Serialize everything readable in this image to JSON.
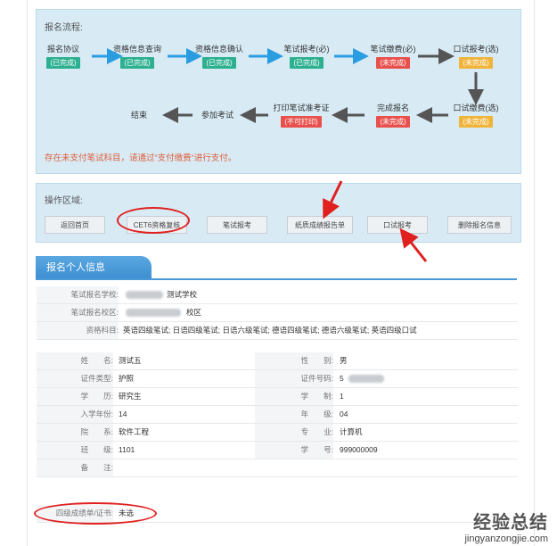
{
  "process": {
    "title": "报名流程:",
    "steps": [
      {
        "label": "报名协议",
        "status": "(已完成)",
        "color": "#2cb08f"
      },
      {
        "label": "资格信息查询",
        "status": "(已完成)",
        "color": "#2cb08f"
      },
      {
        "label": "资格信息确认",
        "status": "(已完成)",
        "color": "#2cb08f"
      },
      {
        "label": "笔试报考(必)",
        "status": "(已完成)",
        "color": "#2cb08f"
      },
      {
        "label": "笔试缴费(必)",
        "status": "(未完成)",
        "color": "#e9504c"
      },
      {
        "label": "口试报考(选)",
        "status": "(未完成)",
        "color": "#f0b43a"
      },
      {
        "label": "口试缴费(选)",
        "status": "(未完成)",
        "color": "#f0b43a"
      },
      {
        "label": "完成报名",
        "status": "(未完成)",
        "color": "#e9504c"
      },
      {
        "label": "打印笔试准考证",
        "status": "(不可打印)",
        "color": "#e9504c"
      },
      {
        "label": "参加考试",
        "status": "",
        "color": ""
      },
      {
        "label": "结束",
        "status": "",
        "color": ""
      }
    ],
    "warning": "存在未支付笔试科目，请通过“支付缴费”进行支付。"
  },
  "operations": {
    "title": "操作区域:",
    "buttons": [
      "返回首页",
      "CET6资格复核",
      "笔试报考",
      "纸质成绩报告单",
      "口试报考",
      "删除报名信息"
    ]
  },
  "info": {
    "title": "报名个人信息",
    "school_label": "笔试报名学校:",
    "school_value": "测试学校",
    "campus_label": "笔试报名校区:",
    "campus_value": "校区",
    "subjects_label": "资格科目:",
    "subjects_value": "英语四级笔试; 日语四级笔试; 日语六级笔试; 德语四级笔试; 德语六级笔试; 英语四级口试",
    "name_label": "姓　　名:",
    "name_value": "测试五",
    "gender_label": "性　　别:",
    "gender_value": "男",
    "idtype_label": "证件类型:",
    "idtype_value": "护照",
    "idno_label": "证件号码:",
    "idno_value": "5",
    "edu_label": "学　　历:",
    "edu_value": "研究生",
    "system_label": "学　　制:",
    "system_value": "1",
    "entry_label": "入学年份:",
    "entry_value": "14",
    "grade_label": "年　　级:",
    "grade_value": "04",
    "dept_label": "院　　系:",
    "dept_value": "软件工程",
    "major_label": "专　　业:",
    "major_value": "计算机",
    "class_label": "班　　级:",
    "class_value": "1101",
    "stuno_label": "学　　号:",
    "stuno_value": "999000009",
    "remark_label": "备　　注:",
    "remark_value": "",
    "cert_label": "四级成绩单/证书:",
    "cert_value": "未选"
  },
  "watermark": {
    "text": "经验总结",
    "url": "jingyanzongjie.com"
  },
  "colors": {
    "done": "#2cb08f",
    "pending": "#e9504c",
    "optional": "#f0b43a",
    "arrow_blue": "#2a9ce0",
    "annotation": "#e0201f"
  }
}
